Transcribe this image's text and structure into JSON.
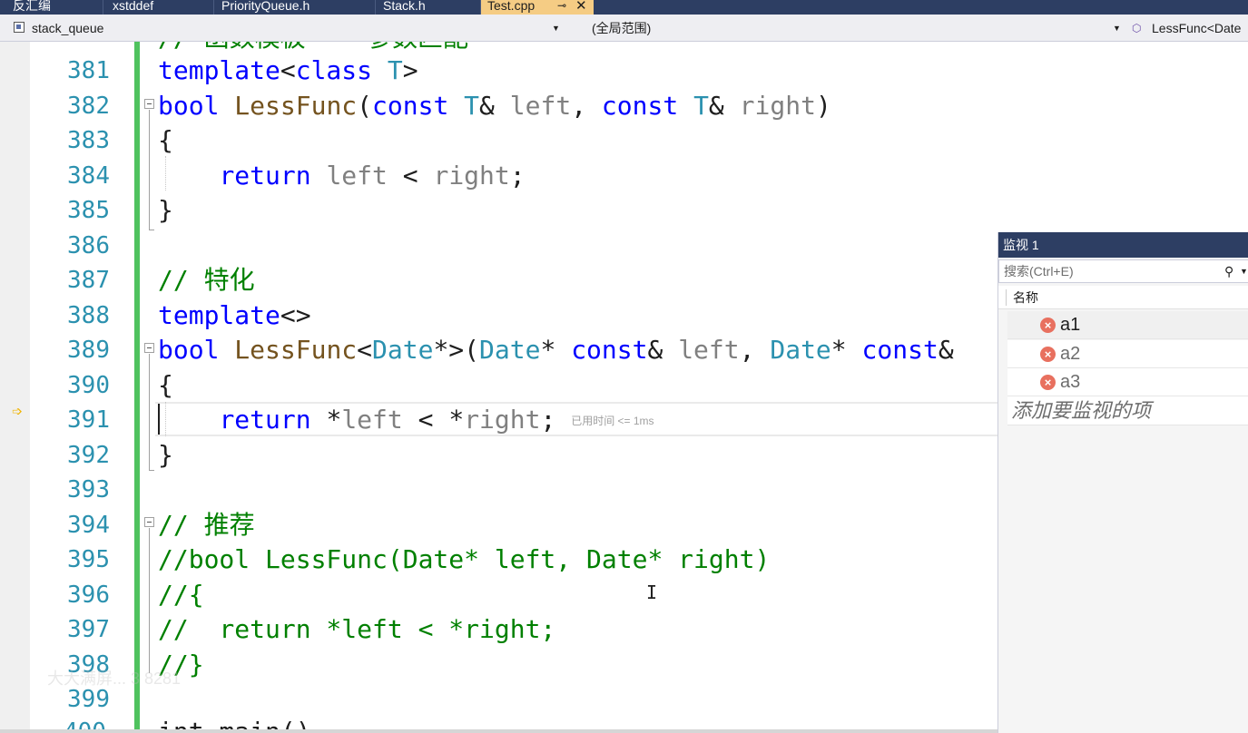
{
  "colors": {
    "tab_bar_bg": "#2d3e63",
    "active_tab_bg": "#f5cc84",
    "keyword": "#0000ff",
    "function": "#74531f",
    "type": "#2b91af",
    "parameter": "#808080",
    "comment": "#008000",
    "line_number": "#2b91af",
    "change_bar": "#4fc25e",
    "error_icon": "#e8705f"
  },
  "tabs": [
    {
      "label": "反汇编",
      "active": false
    },
    {
      "label": "xstddef",
      "active": false
    },
    {
      "label": "PriorityQueue.h",
      "active": false
    },
    {
      "label": "Stack.h",
      "active": false
    },
    {
      "label": "Test.cpp",
      "active": true,
      "pin_icon": "pin-icon",
      "close_icon": "close-icon"
    }
  ],
  "nav": {
    "project": "stack_queue",
    "scope": "(全局范围)",
    "member": "LessFunc<Date",
    "member_icon": "cube-icon"
  },
  "editor": {
    "partial_top_line": "// 函数模板 —— 参数匹配",
    "partial_bottom_line": "int main()",
    "lines": [
      {
        "n": "381",
        "parts": [
          [
            "kw",
            "template"
          ],
          [
            "pl",
            "<"
          ],
          [
            "kw",
            "class"
          ],
          [
            "pl",
            " "
          ],
          [
            "ty",
            "T"
          ],
          [
            "pl",
            ">"
          ]
        ]
      },
      {
        "n": "382",
        "parts": [
          [
            "kw",
            "bool"
          ],
          [
            "pl",
            " "
          ],
          [
            "fn",
            "LessFunc"
          ],
          [
            "pl",
            "("
          ],
          [
            "kw",
            "const"
          ],
          [
            "pl",
            " "
          ],
          [
            "ty",
            "T"
          ],
          [
            "pl",
            "& "
          ],
          [
            "pm",
            "left"
          ],
          [
            "pl",
            ", "
          ],
          [
            "kw",
            "const"
          ],
          [
            "pl",
            " "
          ],
          [
            "ty",
            "T"
          ],
          [
            "pl",
            "& "
          ],
          [
            "pm",
            "right"
          ],
          [
            "pl",
            ")"
          ]
        ]
      },
      {
        "n": "383",
        "parts": [
          [
            "pl",
            "{"
          ]
        ]
      },
      {
        "n": "384",
        "parts": [
          [
            "pl",
            "    "
          ],
          [
            "kw",
            "return"
          ],
          [
            "pl",
            " "
          ],
          [
            "pm",
            "left"
          ],
          [
            "pl",
            " < "
          ],
          [
            "pm",
            "right"
          ],
          [
            "pl",
            ";"
          ]
        ]
      },
      {
        "n": "385",
        "parts": [
          [
            "pl",
            "}"
          ]
        ]
      },
      {
        "n": "386",
        "parts": []
      },
      {
        "n": "387",
        "parts": [
          [
            "cm",
            "// 特化"
          ]
        ]
      },
      {
        "n": "388",
        "parts": [
          [
            "kw",
            "template"
          ],
          [
            "pl",
            "<>"
          ]
        ]
      },
      {
        "n": "389",
        "parts": [
          [
            "kw",
            "bool"
          ],
          [
            "pl",
            " "
          ],
          [
            "fn",
            "LessFunc"
          ],
          [
            "pl",
            "<"
          ],
          [
            "ty",
            "Date"
          ],
          [
            "pl",
            "*>("
          ],
          [
            "ty",
            "Date"
          ],
          [
            "pl",
            "* "
          ],
          [
            "kw",
            "const"
          ],
          [
            "pl",
            "& "
          ],
          [
            "pm",
            "left"
          ],
          [
            "pl",
            ", "
          ],
          [
            "ty",
            "Date"
          ],
          [
            "pl",
            "* "
          ],
          [
            "kw",
            "const"
          ],
          [
            "pl",
            "&"
          ]
        ]
      },
      {
        "n": "390",
        "parts": [
          [
            "pl",
            "{"
          ]
        ]
      },
      {
        "n": "391",
        "parts": [
          [
            "pl",
            "    "
          ],
          [
            "kw",
            "return"
          ],
          [
            "pl",
            " *"
          ],
          [
            "pm",
            "left"
          ],
          [
            "pl",
            " < *"
          ],
          [
            "pm",
            "right"
          ],
          [
            "pl",
            "; "
          ]
        ],
        "hint": "已用时间 <= 1ms"
      },
      {
        "n": "392",
        "parts": [
          [
            "pl",
            "}"
          ]
        ]
      },
      {
        "n": "393",
        "parts": []
      },
      {
        "n": "394",
        "parts": [
          [
            "cm",
            "// 推荐"
          ]
        ]
      },
      {
        "n": "395",
        "parts": [
          [
            "cm",
            "//bool LessFunc(Date* left, Date* right)"
          ]
        ]
      },
      {
        "n": "396",
        "parts": [
          [
            "cm",
            "//{"
          ]
        ]
      },
      {
        "n": "397",
        "parts": [
          [
            "cm",
            "//  return *left < *right;"
          ]
        ]
      },
      {
        "n": "398",
        "parts": [
          [
            "cm",
            "//}"
          ]
        ]
      },
      {
        "n": "399",
        "parts": []
      }
    ],
    "current_line": "391",
    "watermark": "大大满屏...   3     8281"
  },
  "watch": {
    "title": "监视 1",
    "search_placeholder": "搜索(Ctrl+E)",
    "column_name": "名称",
    "items": [
      {
        "name": "a1",
        "icon": "error-icon",
        "selected": true
      },
      {
        "name": "a2",
        "icon": "error-icon",
        "selected": false
      },
      {
        "name": "a3",
        "icon": "error-icon",
        "selected": false
      }
    ],
    "add_placeholder": "添加要监视的项"
  }
}
